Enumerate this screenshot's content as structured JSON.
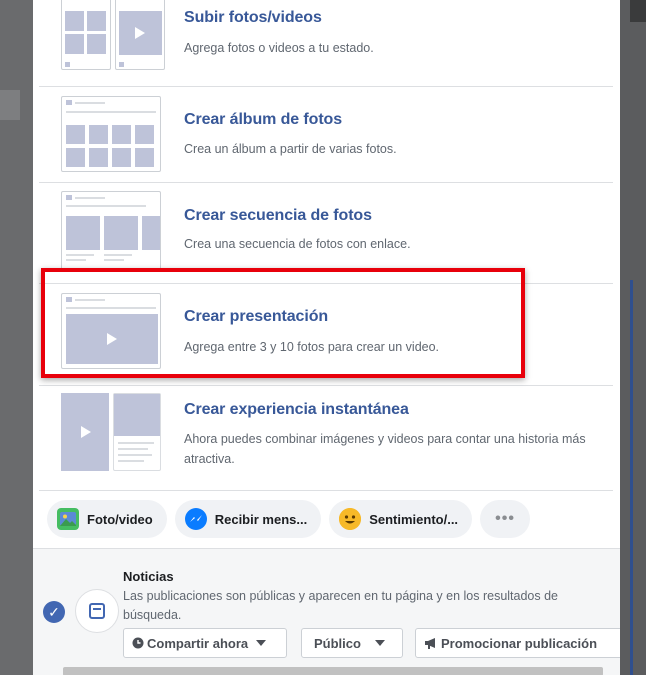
{
  "options": [
    {
      "title": "Subir fotos/videos",
      "desc": "Agrega fotos o videos a tu estado."
    },
    {
      "title": "Crear álbum de fotos",
      "desc": "Crea un álbum a partir de varias fotos."
    },
    {
      "title": "Crear secuencia de fotos",
      "desc": "Crea una secuencia de fotos con enlace."
    },
    {
      "title": "Crear presentación",
      "desc": "Agrega entre 3 y 10 fotos para crear un video."
    },
    {
      "title": "Crear experiencia instantánea",
      "desc": "Ahora puedes combinar imágenes y videos para contar una historia más atractiva."
    }
  ],
  "chips": [
    {
      "label": "Foto/video",
      "icon": "photo-icon"
    },
    {
      "label": "Recibir mens...",
      "icon": "messenger-icon"
    },
    {
      "label": "Sentimiento/...",
      "icon": "emoji-icon"
    },
    {
      "label": "•••",
      "icon": "more-icon"
    }
  ],
  "footer": {
    "title": "Noticias",
    "desc": "Las publicaciones son públicas y aparecen en tu página y en los resultados de búsqueda.",
    "share_label": "Compartir ahora",
    "audience_label": "Público",
    "promote_label": "Promocionar publicación"
  },
  "colors": {
    "accent": "#385898",
    "highlight": "#e8000b",
    "check": "#4267b2"
  }
}
